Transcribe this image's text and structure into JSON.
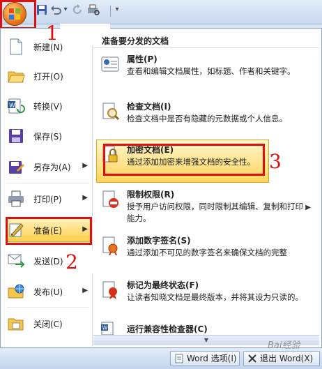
{
  "quick_access": {
    "icons": [
      "office-button-icon",
      "save-icon",
      "undo-icon",
      "undo-dropdown-icon",
      "redo-icon",
      "print-preview-icon",
      "customize-dropdown-icon"
    ]
  },
  "annotations": {
    "step1": "1",
    "step2": "2",
    "step3": "3"
  },
  "left_menu": {
    "items": [
      {
        "label": "新建(N)",
        "icon": "new-document-icon",
        "has_submenu": false
      },
      {
        "label": "打开(O)",
        "icon": "open-folder-icon",
        "has_submenu": false
      },
      {
        "label": "转换(V)",
        "icon": "convert-icon",
        "has_submenu": false
      },
      {
        "label": "保存(S)",
        "icon": "save-icon",
        "has_submenu": false
      },
      {
        "label": "另存为(A)",
        "icon": "save-as-icon",
        "has_submenu": true
      },
      {
        "label": "打印(P)",
        "icon": "printer-icon",
        "has_submenu": true
      },
      {
        "label": "准备(E)",
        "icon": "prepare-icon",
        "has_submenu": true
      },
      {
        "label": "发送(D)",
        "icon": "send-icon",
        "has_submenu": true
      },
      {
        "label": "发布(U)",
        "icon": "publish-icon",
        "has_submenu": true
      },
      {
        "label": "关闭(C)",
        "icon": "close-folder-icon",
        "has_submenu": false
      }
    ]
  },
  "right_panel": {
    "header": "准备要分发的文档",
    "items": [
      {
        "title": "属性(P)",
        "desc": "查看和编辑文档属性，如标题、作者和关键字。",
        "icon": "properties-icon"
      },
      {
        "title": "检查文档(I)",
        "desc": "检查文档中是否有隐藏的元数据或个人信息。",
        "icon": "inspect-document-icon"
      },
      {
        "title": "加密文档(E)",
        "desc": "通过添加加密来增强文档的安全性。",
        "icon": "encrypt-lock-icon"
      },
      {
        "title": "限制权限(R)",
        "desc": "授予用户访问权限，同时限制其编辑、复制和打印能力。",
        "icon": "restrict-permission-icon"
      },
      {
        "title": "添加数字签名(S)",
        "desc": "通过添加不可见的数字签名来确保文档的完整",
        "icon": "digital-signature-icon"
      },
      {
        "title": "标记为最终状态(F)",
        "desc": "让读者知晓文档是最终版本，并将其设为只读的。",
        "icon": "mark-final-icon"
      },
      {
        "title": "运行兼容性检查器(C)",
        "desc": "",
        "icon": "compatibility-checker-icon"
      }
    ]
  },
  "bottom_bar": {
    "word_options": "Word 选项(I)",
    "exit_word": "退出 Word(X)"
  },
  "watermark": "Bai经验",
  "colors": {
    "highlight": "#ffd04a",
    "annotation_red": "#e01010",
    "office_orange": "#e8731a"
  }
}
